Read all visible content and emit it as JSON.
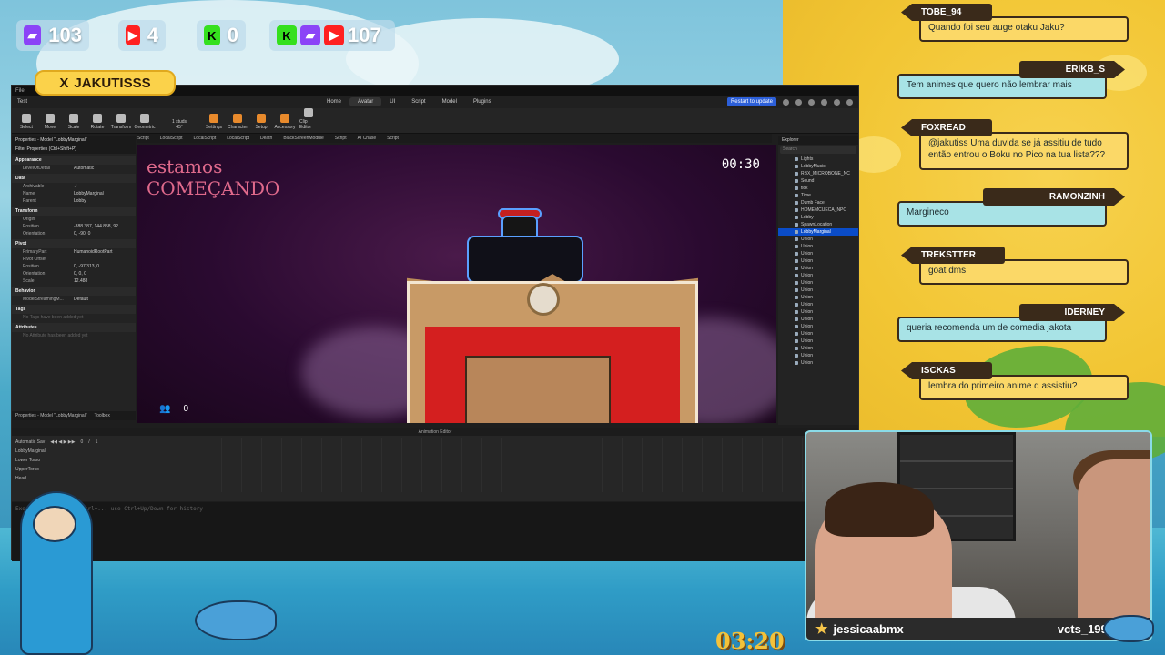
{
  "stats": {
    "twitch": "103",
    "youtube": "4",
    "kick": "0",
    "total": "107"
  },
  "nametag": {
    "icon": "X",
    "label": "JAKUTISSS"
  },
  "studio": {
    "menu_tabs": [
      "Home",
      "Avatar",
      "UI",
      "Script",
      "Model",
      "Plugins"
    ],
    "active_tab": "Avatar",
    "update_button": "Restart to update",
    "tools": [
      "Select",
      "Move",
      "Scale",
      "Rotate",
      "Transform",
      "Geometric",
      "Settings",
      "Character",
      "Setup",
      "Accessory",
      "Clip Editor"
    ],
    "stud_label": "1 studs",
    "angle_label": "45°",
    "doc_tabs": [
      "Script",
      "LocalScript",
      "LocalScript",
      "LocalScript",
      "Death",
      "BlackScreenModule",
      "Script",
      "AI Chase",
      "Script"
    ],
    "properties": {
      "header": "Properties - Model \"LobbyMarginal\"",
      "filter": "Filter Properties (Ctrl+Shift+P)",
      "sections": [
        {
          "name": "Appearance",
          "rows": [
            [
              "LevelOfDetail",
              "Automatic"
            ]
          ]
        },
        {
          "name": "Data",
          "rows": [
            [
              "Archivable",
              "✓"
            ],
            [
              "Name",
              "LobbyMarginal"
            ],
            [
              "Parent",
              "Lobby"
            ]
          ]
        },
        {
          "name": "Transform",
          "rows": [
            [
              "Origin",
              ""
            ],
            [
              "Position",
              "-388.387, 144.858, 92..."
            ],
            [
              "Orientation",
              "0, -90, 0"
            ]
          ]
        },
        {
          "name": "Pivot",
          "rows": [
            [
              "PrimaryPart",
              "HumanoidRootPart"
            ],
            [
              "Pivot Offset",
              ""
            ],
            [
              "Position",
              "0, -97.313, 0"
            ],
            [
              "Orientation",
              "0, 0, 0"
            ],
            [
              "Scale",
              "12.488"
            ]
          ]
        },
        {
          "name": "Behavior",
          "rows": [
            [
              "ModelStreamingM...",
              "Default"
            ]
          ]
        },
        {
          "name": "Tags",
          "rows": [
            [
              "No Tags have been added yet",
              ""
            ]
          ]
        },
        {
          "name": "Attributes",
          "rows": [
            [
              "No Attribute has been added yet",
              ""
            ]
          ]
        }
      ],
      "footer_tabs": [
        "Properties - Model \"LobbyMarginal\"",
        "Toolbox"
      ]
    },
    "viewport": {
      "title_line1": "estamos",
      "title_line2": "COMEÇANDO",
      "timer": "00:30",
      "players": "0"
    },
    "explorer": {
      "header": "Explorer",
      "search_placeholder": "Search",
      "items": [
        "Lights",
        "LobbyMusic",
        "RBX_MICROBONE_NC",
        "Sound",
        "tick",
        "Time",
        "Dumb Face",
        "HOMEMCUECA_NPC",
        "Lobby",
        "SpawnLocation",
        "LobbyMarginal",
        "Union",
        "Union",
        "Union",
        "Union",
        "Union",
        "Union",
        "Union",
        "Union",
        "Union",
        "Union",
        "Union",
        "Union",
        "Union",
        "Union",
        "Union",
        "Union",
        "Union",
        "Union"
      ],
      "selected_index": 10
    },
    "animation": {
      "title": "Animation Editor",
      "dropdown": "Automatic Sav",
      "frame": "0",
      "frame_total": "1",
      "tracks": [
        "LobbyMarginal",
        "Lower Torso",
        "UpperTorso",
        "Head"
      ]
    },
    "command_bar": "Execute script with Ctrl+... use Ctrl+Up/Down for history"
  },
  "chat": [
    {
      "user": "TOBE_94",
      "message": "Quando foi seu auge otaku Jaku?",
      "side": "left",
      "color": "yellow"
    },
    {
      "user": "ERIKB_S",
      "message": "Tem animes que quero não lembrar mais",
      "side": "right",
      "color": "blue"
    },
    {
      "user": "FOXREAD",
      "message": "@jakutiss Uma duvida se já assitiu de tudo então entrou o Boku no Pico na tua lista???",
      "side": "left",
      "color": "yellow"
    },
    {
      "user": "RAMONZINH",
      "message": "Margineco",
      "side": "right",
      "color": "blue"
    },
    {
      "user": "TREKSTTER",
      "message": "goat dms",
      "side": "left",
      "color": "yellow"
    },
    {
      "user": "IDERNEY",
      "message": "queria recomenda um de comedia jakota",
      "side": "right",
      "color": "blue"
    },
    {
      "user": "ISCKAS",
      "message": "lembra do primeiro anime q assistiu?",
      "side": "left",
      "color": "yellow"
    }
  ],
  "webcam": {
    "left_name": "jessicaabmx",
    "right_name": "vcts_1993"
  },
  "stream_timer": "03:20"
}
